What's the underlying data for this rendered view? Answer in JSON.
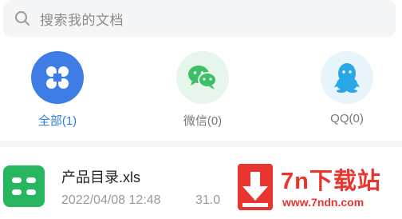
{
  "search": {
    "placeholder": "搜索我的文档",
    "icon": "search-icon"
  },
  "categories": [
    {
      "label": "全部(1)",
      "icon": "grid-four-icon",
      "active": true,
      "icon_color": "#ffffff",
      "bg_color": "#3e7ce6"
    },
    {
      "label": "微信(0)",
      "icon": "wechat-icon",
      "active": false,
      "icon_color": "#3cbf66",
      "bg_color": "#e6f6ea"
    },
    {
      "label": "QQ(0)",
      "icon": "qq-icon",
      "active": false,
      "icon_color": "#29a8e6",
      "bg_color": "#e7f5fb"
    }
  ],
  "files": [
    {
      "name": "产品目录.xls",
      "date": "2022/04/08 12:48",
      "size": "31.0",
      "icon": "spreadsheet-icon",
      "icon_color": "#27b65f"
    }
  ],
  "watermark": {
    "title": "7n下载站",
    "url": "www.7ndn.com",
    "color": "#e8352e",
    "icon": "download-arrow-icon"
  }
}
